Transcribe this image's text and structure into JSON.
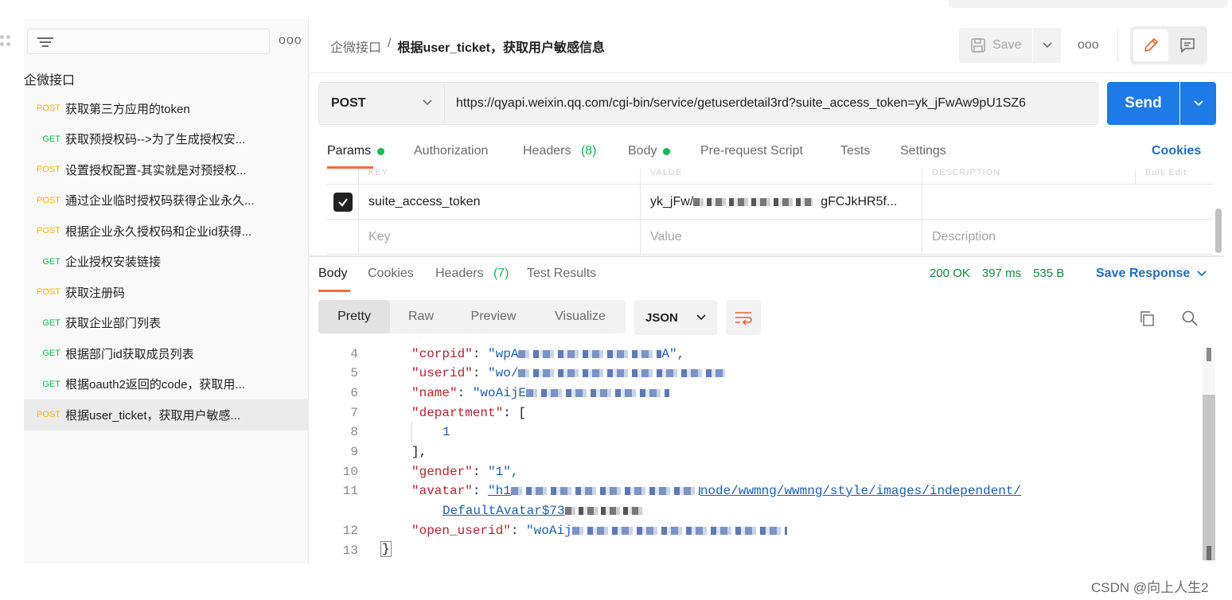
{
  "sidebar": {
    "collection_name": "企微接口",
    "items": [
      {
        "method": "POST",
        "label": "获取第三方应用的token"
      },
      {
        "method": "GET",
        "label": "获取预授权码-->为了生成授权安..."
      },
      {
        "method": "POST",
        "label": "设置授权配置-其实就是对预授权..."
      },
      {
        "method": "POST",
        "label": "通过企业临时授权码获得企业永久..."
      },
      {
        "method": "POST",
        "label": "根据企业永久授权码和企业id获得..."
      },
      {
        "method": "GET",
        "label": "企业授权安装链接"
      },
      {
        "method": "POST",
        "label": "获取注册码"
      },
      {
        "method": "GET",
        "label": "获取企业部门列表"
      },
      {
        "method": "GET",
        "label": "根据部门id获取成员列表"
      },
      {
        "method": "GET",
        "label": "根据oauth2返回的code，获取用..."
      },
      {
        "method": "POST",
        "label": "根据user_ticket，获取用户敏感...",
        "active": true
      }
    ]
  },
  "header": {
    "breadcrumb_parent": "企微接口",
    "breadcrumb_sep": "/",
    "breadcrumb_current": "根据user_ticket，获取用户敏感信息",
    "save_label": "Save",
    "more_label": "ooo"
  },
  "request": {
    "method": "POST",
    "url": "https://qyapi.weixin.qq.com/cgi-bin/service/getuserdetail3rd?suite_access_token=yk_jFwAw9pU1SZ6",
    "send_label": "Send",
    "tabs": [
      {
        "label": "Params",
        "dot": true
      },
      {
        "label": "Authorization"
      },
      {
        "label": "Headers",
        "count": "(8)"
      },
      {
        "label": "Body",
        "dot": true
      },
      {
        "label": "Pre-request Script"
      },
      {
        "label": "Tests"
      },
      {
        "label": "Settings"
      }
    ],
    "cookies_label": "Cookies",
    "params_header_ghost": [
      "KEY",
      "VALUE",
      "DESCRIPTION",
      "Bulk Edit"
    ],
    "param": {
      "key": "suite_access_token",
      "value_start": "yk_jFw/",
      "value_end": "gFCJkHR5f..."
    },
    "placeholders": {
      "key": "Key",
      "value": "Value",
      "description": "Description"
    }
  },
  "response": {
    "tabs": [
      {
        "label": "Body"
      },
      {
        "label": "Cookies"
      },
      {
        "label": "Headers",
        "count": "(7)"
      },
      {
        "label": "Test Results"
      }
    ],
    "status": "200 OK",
    "time": "397 ms",
    "size": "535 B",
    "save_response_label": "Save Response",
    "formats": [
      "Pretty",
      "Raw",
      "Preview",
      "Visualize"
    ],
    "language": "JSON",
    "lines": [
      {
        "n": "4",
        "key": "\"corpid\"",
        "sep": ": ",
        "val_start": "\"wpA",
        "val_end": "A\","
      },
      {
        "n": "5",
        "key": "\"userid\"",
        "sep": ": ",
        "val_start": "\"wo/",
        "val_end": ""
      },
      {
        "n": "6",
        "key": "\"name\"",
        "sep": ": ",
        "val_start": "\"woAijE",
        "val_end": ""
      },
      {
        "n": "7",
        "key": "\"department\"",
        "sep": ": ",
        "val_start": "[",
        "val_end": ""
      },
      {
        "n": "8",
        "val_start": "1"
      },
      {
        "n": "9",
        "val_start": "],"
      },
      {
        "n": "10",
        "key": "\"gender\"",
        "sep": ": ",
        "val_start": "\"1\","
      },
      {
        "n": "11",
        "key": "\"avatar\"",
        "sep": ": ",
        "val_start": "\"h1",
        "val_end": "node/wwmng/wwmng/style/images/independent/",
        "wrap_start": "DefaultAvatar$73"
      },
      {
        "n": "12",
        "key": "\"open_userid\"",
        "sep": ": ",
        "val_start": "\"woAij"
      },
      {
        "n": "13",
        "val_start": "}"
      }
    ]
  },
  "watermark": "CSDN @向上人生2"
}
